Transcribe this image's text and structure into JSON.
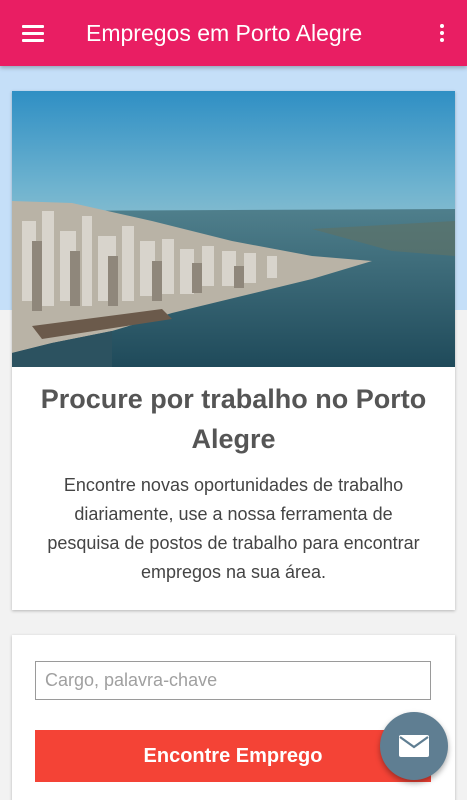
{
  "appbar": {
    "title": "Empregos em Porto Alegre",
    "menu_icon": "hamburger-menu-icon",
    "overflow_icon": "more-vertical-icon",
    "color": "#e91e63"
  },
  "hero": {
    "image": "aerial-city-photo",
    "title": "Procure por trabalho no Porto Alegre",
    "description": "Encontre novas oportunidades de trabalho diariamente, use a nossa ferramenta de pesquisa de postos de trabalho para encontrar empregos na sua área."
  },
  "search": {
    "placeholder": "Cargo, palavra-chave",
    "value": "",
    "button_label": "Encontre Emprego",
    "button_color": "#f44336"
  },
  "fab": {
    "icon": "email-icon",
    "color": "#5f7e92"
  }
}
